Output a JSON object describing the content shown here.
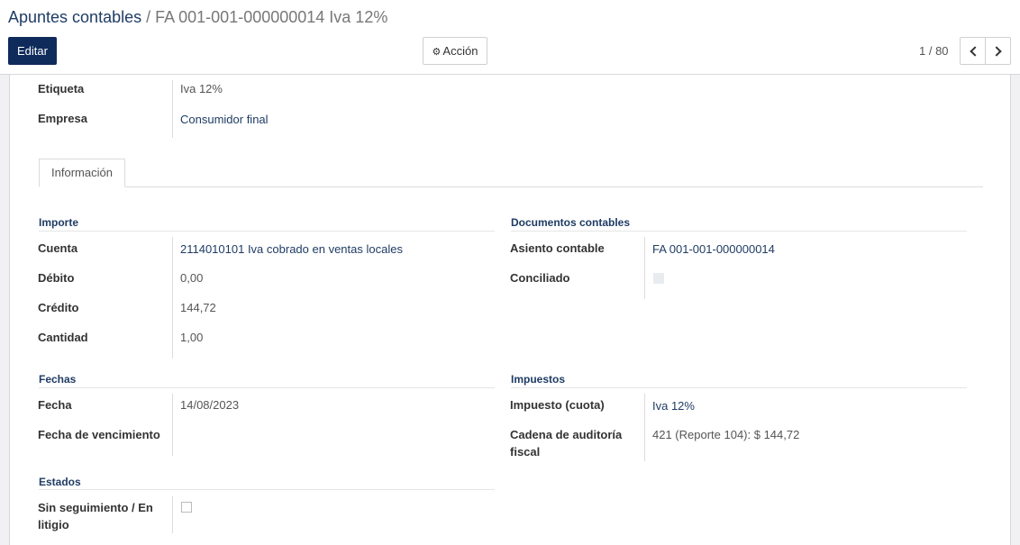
{
  "breadcrumb": {
    "parent": "Apuntes contables",
    "separator": " / ",
    "current": "FA 001-001-000000014 Iva 12%"
  },
  "toolbar": {
    "edit_label": "Editar",
    "action_label": "Acción",
    "action_icon": "gear-icon"
  },
  "pager": {
    "value": "1 / 80"
  },
  "header_fields": {
    "etiqueta_label": "Etiqueta",
    "etiqueta_value": "Iva 12%",
    "empresa_label": "Empresa",
    "empresa_value": "Consumidor final"
  },
  "tabs": [
    {
      "label": "Información"
    }
  ],
  "importe": {
    "title": "Importe",
    "cuenta_label": "Cuenta",
    "cuenta_value": "2114010101 Iva cobrado en ventas locales",
    "debito_label": "Débito",
    "debito_value": "0,00",
    "credito_label": "Crédito",
    "credito_value": "144,72",
    "cantidad_label": "Cantidad",
    "cantidad_value": "1,00"
  },
  "documentos": {
    "title": "Documentos contables",
    "asiento_label": "Asiento contable",
    "asiento_value": "FA 001-001-000000014",
    "conciliado_label": "Conciliado",
    "conciliado_checked": false
  },
  "fechas": {
    "title": "Fechas",
    "fecha_label": "Fecha",
    "fecha_value": "14/08/2023",
    "vencimiento_label": "Fecha de vencimiento",
    "vencimiento_value": ""
  },
  "impuestos": {
    "title": "Impuestos",
    "impuesto_label": "Impuesto (cuota)",
    "impuesto_value": "Iva 12%",
    "cadena_label_1": "Cadena de auditoría",
    "cadena_label_2": "fiscal",
    "cadena_value": "421 (Reporte 104): $ 144,72"
  },
  "estados": {
    "title": "Estados",
    "seguimiento_label_1": "Sin seguimiento / En",
    "seguimiento_label_2": "litigio",
    "seguimiento_checked": false
  }
}
